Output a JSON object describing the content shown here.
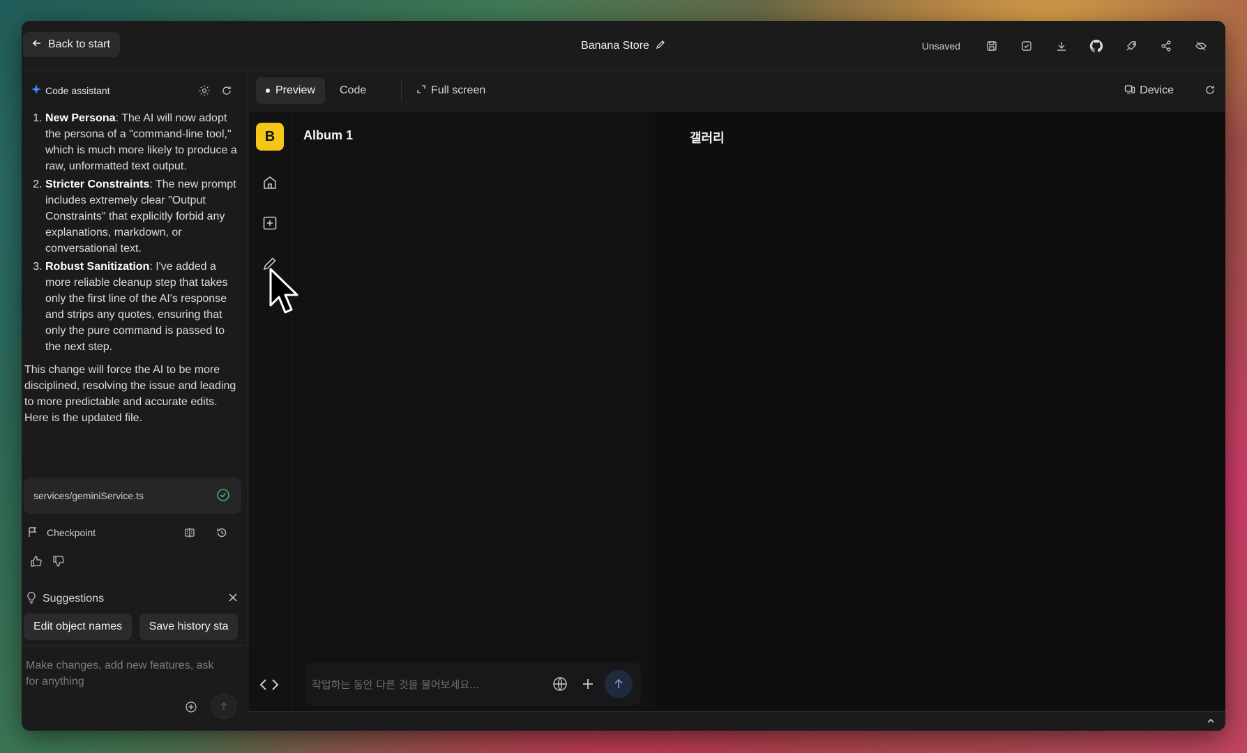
{
  "header": {
    "back_label": "Back to start",
    "project_title": "Banana Store",
    "save_status": "Unsaved",
    "icons": [
      "save-icon",
      "save-as-icon",
      "download-icon",
      "github-icon",
      "deploy-icon",
      "share-icon",
      "hide-icon"
    ]
  },
  "assistant": {
    "title": "Code assistant",
    "steps": [
      {
        "bold": "New Persona",
        "text": ": The AI will now adopt the persona of a \"command-line tool,\" which is much more likely to produce a raw, unformatted text output."
      },
      {
        "bold": "Stricter Constraints",
        "text": ": The new prompt includes extremely clear \"Output Constraints\" that explicitly forbid any explanations, markdown, or conversational text."
      },
      {
        "bold": "Robust Sanitization",
        "text": ": I've added a more reliable cleanup step that takes only the first line of the AI's response and strips any quotes, ensuring that only the pure command is passed to the next step."
      }
    ],
    "summary": "This change will force the AI to be more disciplined, resolving the issue and leading to more predictable and accurate edits. Here is the updated file.",
    "file_name": "services/geminiService.ts",
    "checkpoint_label": "Checkpoint",
    "suggestions_label": "Suggestions",
    "suggestions": [
      "Edit object names",
      "Save history sta"
    ],
    "prompt_placeholder": "Make changes, add new features, ask for anything"
  },
  "toolbar": {
    "tab_preview": "Preview",
    "tab_code": "Code",
    "full_screen": "Full screen",
    "device": "Device"
  },
  "app": {
    "logo_letter": "B",
    "album_title": "Album 1",
    "gallery_title": "갤러리",
    "chat_placeholder": "작업하는 동안 다른 것을 물어보세요..."
  },
  "colors": {
    "accent_yellow": "#f5c518",
    "success_green": "#3fbf62",
    "sparkle_blue": "#3b8cff"
  }
}
